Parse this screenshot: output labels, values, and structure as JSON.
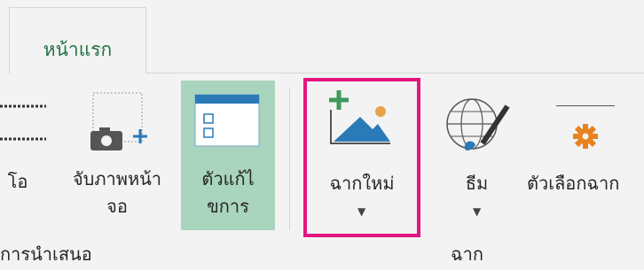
{
  "tabs": {
    "home": "หน้าแรก"
  },
  "ribbon": {
    "buttons": {
      "video_partial": "โอ",
      "screenshot": [
        "จับภาพหน้า",
        "จอ"
      ],
      "editor": [
        "ตัวแก้ไ",
        "ขการ"
      ],
      "new_slide": "ฉากใหม่",
      "theme": "ธีม",
      "slide_options": "ตัวเลือกฉาก"
    },
    "groups": {
      "presentation": "การนำเสนอ",
      "slides": "ฉาก"
    }
  },
  "colors": {
    "tab_text": "#217346",
    "highlight": "#e3157f",
    "selected": "#a9d4bd",
    "icon_blue": "#2b7ab8",
    "icon_orange": "#e8821e"
  },
  "icons": [
    "camera-icon",
    "editor-icon",
    "new-slide-icon",
    "theme-icon",
    "gear-icon"
  ]
}
